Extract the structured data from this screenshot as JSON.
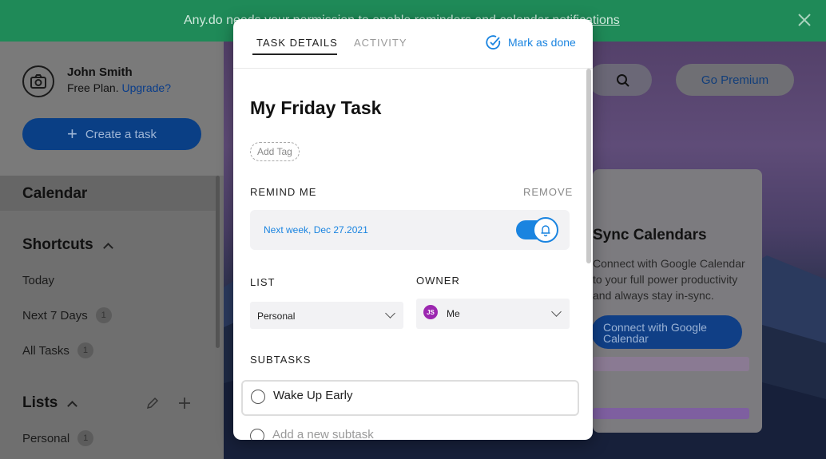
{
  "banner": {
    "text": "Any.do needs your permission to enable reminders and calendar ",
    "link": "notifications"
  },
  "user": {
    "name": "John Smith",
    "plan": "Free Plan.",
    "upgrade": "Upgrade?"
  },
  "sidebar": {
    "create_label": "Create a task",
    "calendar": "Calendar",
    "shortcuts_title": "Shortcuts",
    "shortcuts": [
      {
        "label": "Today",
        "count": ""
      },
      {
        "label": "Next 7 Days",
        "count": "1"
      },
      {
        "label": "All Tasks",
        "count": "1"
      }
    ],
    "lists_title": "Lists",
    "lists": [
      {
        "label": "Personal",
        "count": "1"
      }
    ]
  },
  "header": {
    "premium_label": "Go Premium"
  },
  "sync_card": {
    "title": "Sync Calendars",
    "description": "Connect with Google Calendar to your full power productivity and always stay in-sync.",
    "button": "Connect with Google Calendar"
  },
  "modal": {
    "tabs": [
      {
        "label": "TASK DETAILS",
        "active": true
      },
      {
        "label": "ACTIVITY",
        "active": false
      }
    ],
    "mark_done": "Mark as done",
    "title": "My Friday Task",
    "add_tag": "Add Tag",
    "remind_label": "REMIND ME",
    "remove_label": "REMOVE",
    "remind_date": "Next week, Dec 27.2021",
    "remind_enabled": true,
    "list_label": "LIST",
    "list_value": "Personal",
    "owner_label": "OWNER",
    "owner_initials": "JS",
    "owner_value": "Me",
    "subtasks_label": "SUBTASKS",
    "subtasks": [
      {
        "label": "Wake Up Early",
        "done": false
      }
    ],
    "new_subtask_placeholder": "Add a new subtask"
  },
  "colors": {
    "banner": "#1f8a58",
    "accent": "#1a84e0",
    "owner_avatar": "#9c27b0"
  }
}
